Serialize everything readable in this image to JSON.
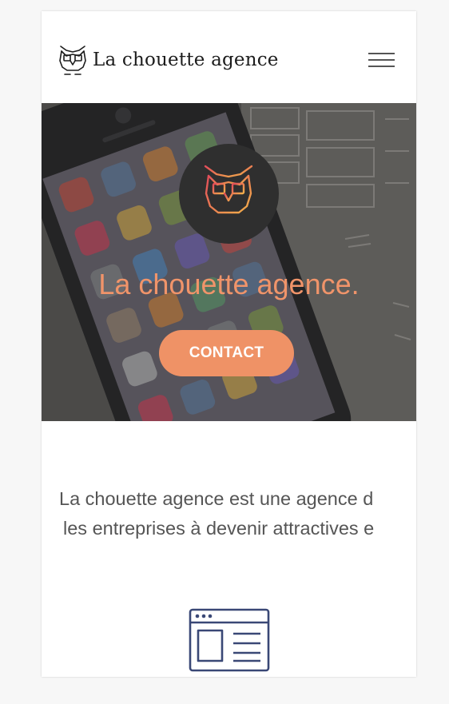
{
  "header": {
    "brand_name": "La chouette agence",
    "logo_icon": "owl-icon",
    "menu_icon": "hamburger-menu-icon"
  },
  "hero": {
    "badge_icon": "owl-icon",
    "title": "La chouette agence.",
    "cta_label": "CONTACT",
    "title_color": "#f0946a",
    "cta_color": "#ef9266"
  },
  "intro": {
    "line1": "La chouette agence est une agence d",
    "line2": "les entreprises à devenir attractives e"
  },
  "services": {
    "first_icon": "webpage-layout-icon",
    "icon_color": "#3a4876"
  }
}
